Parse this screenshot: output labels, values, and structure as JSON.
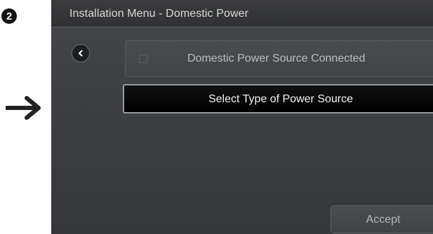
{
  "step": {
    "number": "2"
  },
  "screen": {
    "title": "Installation Menu - Domestic Power",
    "back_button": {
      "icon": "chevron-left-icon"
    },
    "option": {
      "label": "Domestic Power Source Connected",
      "checked": false
    },
    "select_button": {
      "label": "Select Type of Power Source"
    },
    "accept_button": {
      "label": "Accept"
    }
  },
  "colors": {
    "screen_background": "#3f4144",
    "title_bar": "#333436",
    "selected_button_fill": "#000000",
    "selected_button_border": "#9a9c9f",
    "arrow": "#222222"
  }
}
